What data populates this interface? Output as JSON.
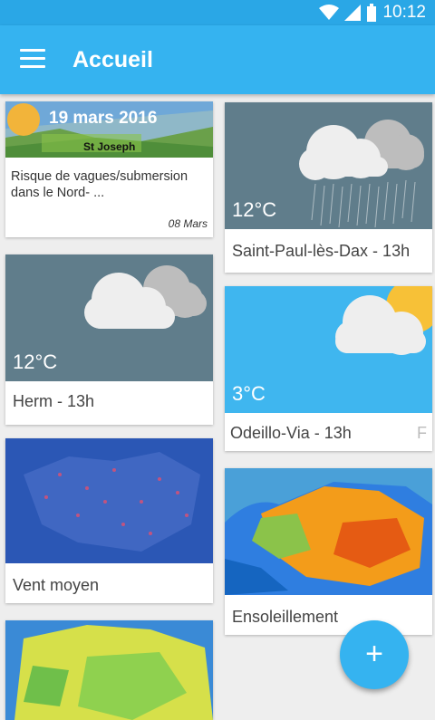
{
  "status_bar": {
    "time": "10:12"
  },
  "app_bar": {
    "title": "Accueil"
  },
  "cards": {
    "news": {
      "date": "19 mars 2016",
      "saint": "St Joseph",
      "headline": "Risque de vagues/submersion dans le Nord- ...",
      "meta": "08 Mars"
    },
    "saint_paul": {
      "temperature": "12°C",
      "label": "Saint-Paul-lès-Dax - 13h"
    },
    "herm": {
      "temperature": "12°C",
      "label": "Herm - 13h"
    },
    "odeillo": {
      "temperature": "3°C",
      "label": "Odeillo-Via - 13h",
      "label_trail": "F"
    },
    "vent_moyen": {
      "label": "Vent moyen"
    },
    "ensoleillement": {
      "label": "Ensoleillement"
    }
  },
  "fab": {
    "label": "+"
  },
  "colors": {
    "accent": "#35b3f0",
    "status_bar": "#2aa7e6",
    "sky": "#3fb6ef"
  }
}
